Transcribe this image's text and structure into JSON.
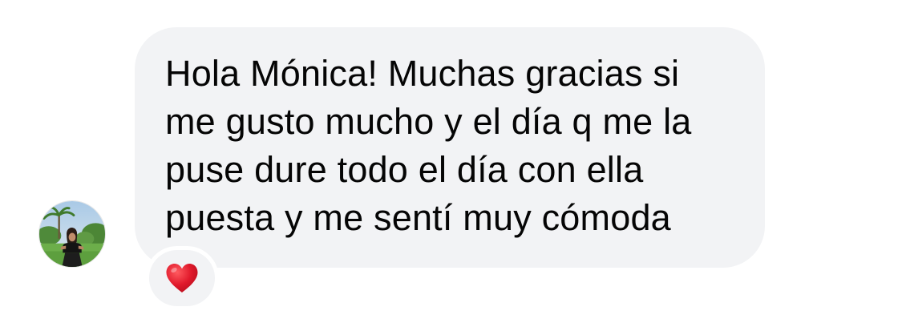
{
  "message": {
    "lines": [
      "Hola Mónica! Muchas gracias si",
      "me gusto mucho y el día q me la",
      "puse dure todo el día con ella",
      "puesta y me sentí muy cómoda"
    ],
    "bubble_color": "#f2f3f5",
    "text_color": "#050505"
  },
  "sender": {
    "avatar_icon": "profile-photo"
  },
  "reaction": {
    "icon": "heart-icon",
    "color": "#e0192b"
  }
}
